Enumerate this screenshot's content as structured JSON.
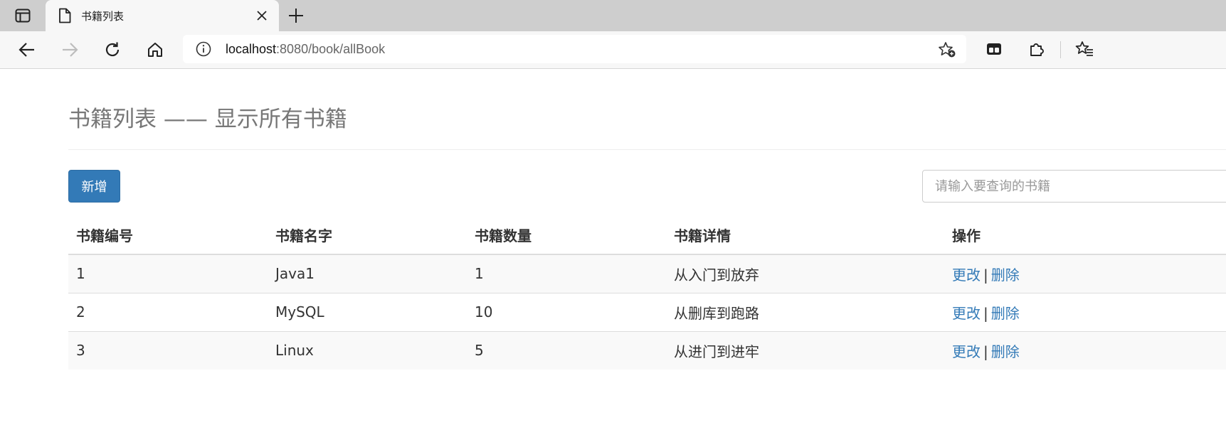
{
  "browser": {
    "tab_title": "书籍列表",
    "url_host": "localhost",
    "url_rest": ":8080/book/allBook"
  },
  "page": {
    "title": "书籍列表 —— 显示所有书籍",
    "add_button": "新增",
    "search_placeholder": "请输入要查询的书籍"
  },
  "table": {
    "headers": [
      "书籍编号",
      "书籍名字",
      "书籍数量",
      "书籍详情",
      "操作"
    ],
    "rows": [
      {
        "id": "1",
        "name": "Java1",
        "count": "1",
        "detail": "从入门到放弃",
        "edit": "更改",
        "sep": "|",
        "delete": "删除"
      },
      {
        "id": "2",
        "name": "MySQL",
        "count": "10",
        "detail": "从删库到跑路",
        "edit": "更改",
        "sep": "|",
        "delete": "删除"
      },
      {
        "id": "3",
        "name": "Linux",
        "count": "5",
        "detail": "从进门到进牢",
        "edit": "更改",
        "sep": "|",
        "delete": "删除"
      }
    ]
  },
  "colors": {
    "primary": "#337ab7",
    "title_gray": "#777777",
    "tabstrip": "#cecece"
  },
  "icons": [
    "tab-actions-icon",
    "document-icon",
    "close-icon",
    "plus-icon",
    "back-arrow-icon",
    "forward-arrow-icon",
    "refresh-icon",
    "home-icon",
    "info-icon",
    "add-favorite-icon",
    "tab-icon",
    "extensions-icon",
    "favorites-icon"
  ]
}
